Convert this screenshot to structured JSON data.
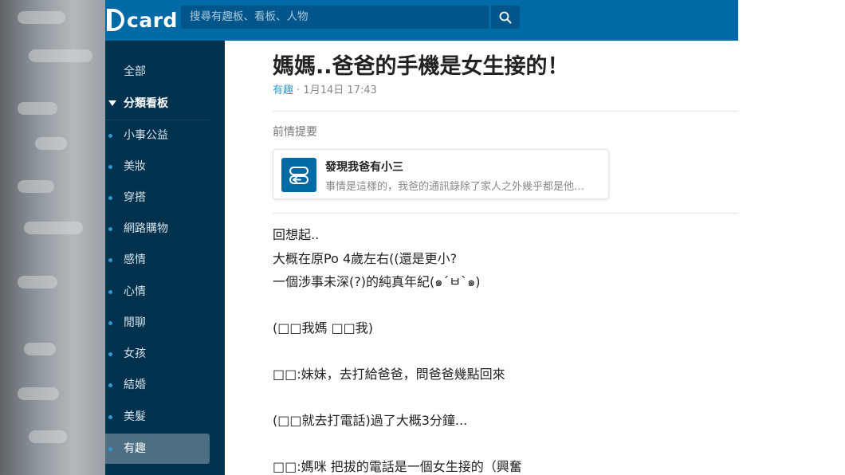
{
  "header": {
    "logo_text": "card",
    "search_placeholder": "搜尋有趣板、看板、人物"
  },
  "sidebar": {
    "all_label": "全部",
    "category_label": "分類看板",
    "items": [
      {
        "label": "小事公益"
      },
      {
        "label": "美妝"
      },
      {
        "label": "穿搭"
      },
      {
        "label": "網路購物"
      },
      {
        "label": "感情"
      },
      {
        "label": "心情"
      },
      {
        "label": "閒聊"
      },
      {
        "label": "女孩"
      },
      {
        "label": "結婚"
      },
      {
        "label": "美髮"
      },
      {
        "label": "有趣"
      }
    ],
    "active_item": "有趣"
  },
  "post": {
    "title": "媽媽..爸爸的手機是女生接的！",
    "board": "有趣",
    "separator": " · ",
    "date": "1月14日 17:43",
    "prev_label": "前情提要",
    "ref_title": "發現我爸有小三",
    "ref_excerpt": "事情是這樣的，我爸的通訊錄除了家人之外幾乎都是他…",
    "lines": [
      "回想起..",
      "大概在原Po 4歲左右((還是更小?",
      "一個涉事未深(?)的純真年紀(๑´ㅂ`๑)",
      "(□□我媽 □□我)",
      "□□:妹妹，去打給爸爸，問爸爸幾點回來",
      "(□□就去打電話)過了大概3分鐘...",
      "□□:媽咪 把拔的電話是一個女生接的（興奮"
    ]
  },
  "colors": {
    "topbar": "#006aa6",
    "sidebar": "#00314d",
    "accent": "#3397cf",
    "active_item_bg": "#4d6f83"
  },
  "icons": {
    "search": "magnifier-icon",
    "ref_card": "swap-arrows-icon",
    "bullet": "dot",
    "category": "caret-down"
  }
}
